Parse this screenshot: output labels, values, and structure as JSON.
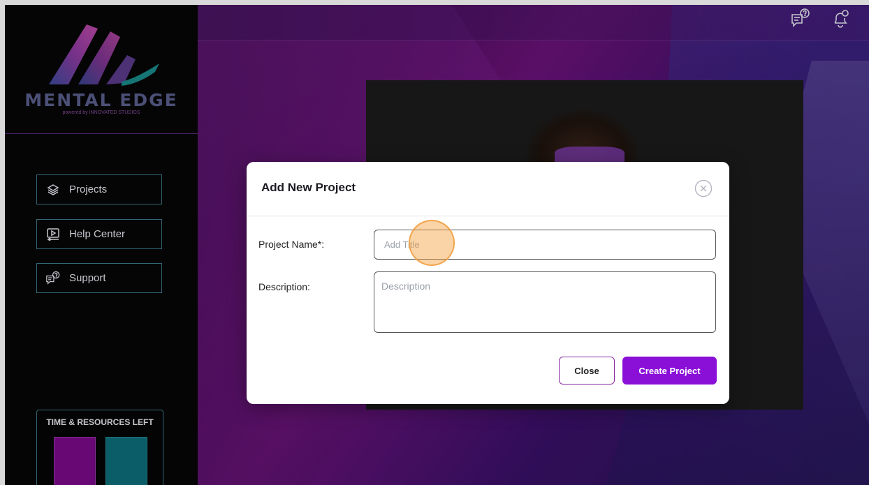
{
  "brand": {
    "name": "MENTAL EDGE",
    "tagline": "powered by INNOVATED STUDIOS"
  },
  "sidebar": {
    "items": [
      {
        "label": "Projects",
        "icon": "layers-icon"
      },
      {
        "label": "Help Center",
        "icon": "video-play-icon"
      },
      {
        "label": "Support",
        "icon": "chat-question-icon"
      }
    ],
    "time_box": {
      "title": "TIME & RESOURCES LEFT",
      "bars": [
        {
          "name": "time",
          "color": "#7a0a8a"
        },
        {
          "name": "resources",
          "color": "#0d6e7a"
        }
      ]
    }
  },
  "header": {
    "icons": [
      "help-chat-icon",
      "bell-icon"
    ]
  },
  "modal": {
    "title": "Add New Project",
    "fields": [
      {
        "label": "Project Name*:",
        "placeholder": "Add Title",
        "value": ""
      },
      {
        "label": "Description:",
        "placeholder": "Description",
        "value": ""
      }
    ],
    "buttons": {
      "close": "Close",
      "create": "Create Project"
    }
  },
  "colors": {
    "accent": "#8a10d8",
    "sidebar_border": "#3d7a8a",
    "modal_bg": "#ffffff"
  }
}
